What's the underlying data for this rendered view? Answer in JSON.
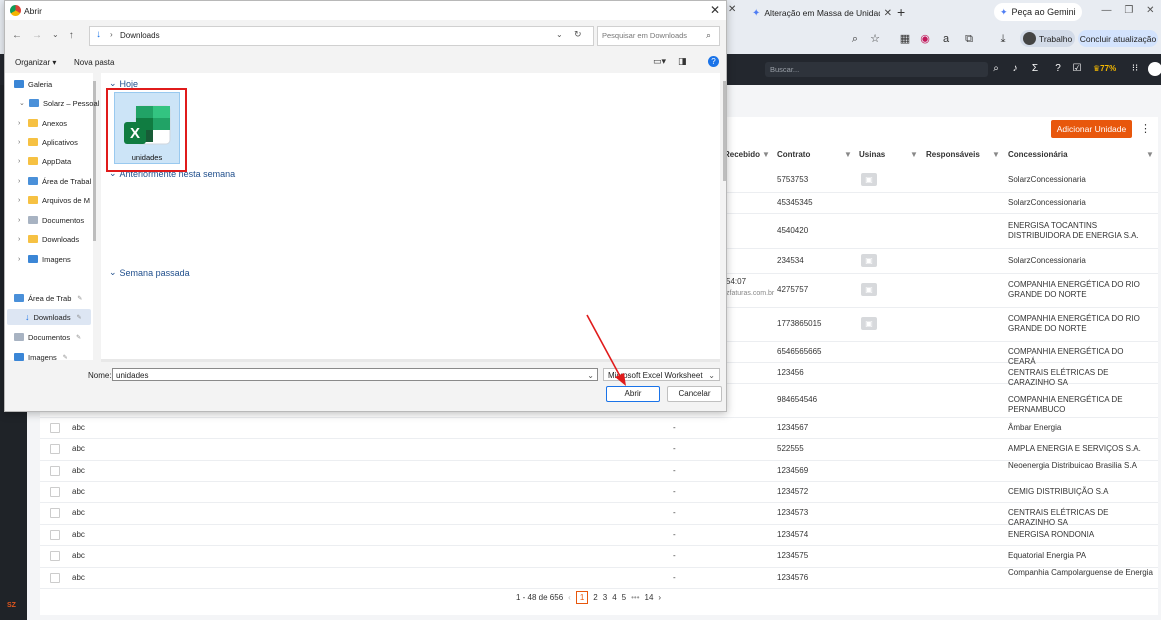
{
  "browser": {
    "tab_partial": "",
    "tab_title": "Alteração em Massa de Unidad",
    "gemini_tab": "Peça ao Gemini",
    "profile": "Trabalho",
    "update_button": "Concluir atualização"
  },
  "app": {
    "search_placeholder": "Buscar...",
    "battery": "77%",
    "add_unit_button": "Adicionar Unidade",
    "logo": "SZ",
    "columns": [
      "Recebido",
      "Contrato",
      "Usinas",
      "Responsáveis",
      "Concessionária"
    ],
    "rows": [
      {
        "name": "",
        "recebido": "",
        "contrato": "5753753",
        "usinas": true,
        "concessionaria": "SolarzConcessionaria"
      },
      {
        "name": "",
        "recebido": "",
        "contrato": "45345345",
        "usinas": false,
        "concessionaria": "SolarzConcessionaria"
      },
      {
        "name": "",
        "recebido": "",
        "contrato": "4540420",
        "usinas": false,
        "concessionaria": "ENERGISA TOCANTINS DISTRIBUIDORA DE ENERGIA S.A."
      },
      {
        "name": "",
        "recebido": "",
        "contrato": "234534",
        "usinas": true,
        "concessionaria": "SolarzConcessionaria"
      },
      {
        "name": "",
        "recebido": "54:07",
        "recebido2": "zfaturas.com.br",
        "contrato": "4275757",
        "usinas": true,
        "concessionaria": "COMPANHIA ENERGÉTICA DO RIO GRANDE DO NORTE"
      },
      {
        "name": "",
        "recebido": "",
        "contrato": "1773865015",
        "usinas": true,
        "concessionaria": "COMPANHIA ENERGÉTICA DO RIO GRANDE DO NORTE"
      },
      {
        "name": "",
        "recebido": "",
        "contrato": "6546565665",
        "usinas": false,
        "concessionaria": "COMPANHIA ENERGÉTICA DO CEARÁ"
      },
      {
        "name": "",
        "recebido": "",
        "contrato": "123456",
        "usinas": false,
        "concessionaria": "CENTRAIS ELÉTRICAS DE CARAZINHO SA"
      },
      {
        "name": "",
        "recebido": "",
        "contrato": "984654546",
        "usinas": false,
        "concessionaria": "COMPANHIA ENERGÉTICA DE PERNAMBUCO"
      },
      {
        "name": "abc",
        "recebido": "-",
        "contrato": "1234567",
        "usinas": false,
        "concessionaria": "Âmbar Energia"
      },
      {
        "name": "abc",
        "recebido": "-",
        "contrato": "522555",
        "usinas": false,
        "concessionaria": "AMPLA ENERGIA E SERVIÇOS S.A."
      },
      {
        "name": "abc",
        "recebido": "-",
        "contrato": "1234569",
        "usinas": false,
        "concessionaria": "Neoenergia Distribuicao Brasilia S.A"
      },
      {
        "name": "abc",
        "recebido": "-",
        "contrato": "1234572",
        "usinas": false,
        "concessionaria": "CEMIG DISTRIBUIÇÃO S.A"
      },
      {
        "name": "abc",
        "recebido": "-",
        "contrato": "1234573",
        "usinas": false,
        "concessionaria": "CENTRAIS ELÉTRICAS DE CARAZINHO SA"
      },
      {
        "name": "abc",
        "recebido": "-",
        "contrato": "1234574",
        "usinas": false,
        "concessionaria": "ENERGISA RONDONIA"
      },
      {
        "name": "abc",
        "recebido": "-",
        "contrato": "1234575",
        "usinas": false,
        "concessionaria": "Equatorial Energia PA"
      },
      {
        "name": "abc",
        "recebido": "-",
        "contrato": "1234576",
        "usinas": false,
        "concessionaria": "Companhia Campolarguense de Energia"
      }
    ],
    "pagination": {
      "summary": "1 - 48 de 656",
      "pages": [
        "1",
        "2",
        "3",
        "4",
        "5",
        "•••",
        "14"
      ],
      "current": "1"
    }
  },
  "dialog": {
    "title": "Abrir",
    "path": "Downloads",
    "search_placeholder": "Pesquisar em Downloads",
    "organize": "Organizar",
    "new_folder": "Nova pasta",
    "nav_items": [
      {
        "label": "Galeria",
        "icon": "gallery-icon"
      },
      {
        "label": "Solarz – Pessoal",
        "icon": "cloud-icon"
      },
      {
        "label": "Anexos",
        "icon": "folder-icon"
      },
      {
        "label": "Aplicativos",
        "icon": "folder-icon"
      },
      {
        "label": "AppData",
        "icon": "folder-icon"
      },
      {
        "label": "Área de Trabal",
        "icon": "desktop-icon"
      },
      {
        "label": "Arquivos de M",
        "icon": "folder-icon"
      },
      {
        "label": "Documentos",
        "icon": "documents-icon"
      },
      {
        "label": "Downloads",
        "icon": "folder-icon"
      },
      {
        "label": "Imagens",
        "icon": "images-icon"
      },
      {
        "label": "Área de Trab",
        "icon": "desktop-icon"
      },
      {
        "label": "Downloads",
        "icon": "download-icon"
      },
      {
        "label": "Documentos",
        "icon": "documents-icon"
      },
      {
        "label": "Imagens",
        "icon": "images-icon"
      }
    ],
    "groups": [
      "Hoje",
      "Anteriormente nesta semana",
      "Semana passada"
    ],
    "file_name": "unidades",
    "name_label": "Nome:",
    "name_value": "unidades",
    "file_type": "Microsoft Excel Worksheet",
    "open_button": "Abrir",
    "cancel_button": "Cancelar"
  }
}
